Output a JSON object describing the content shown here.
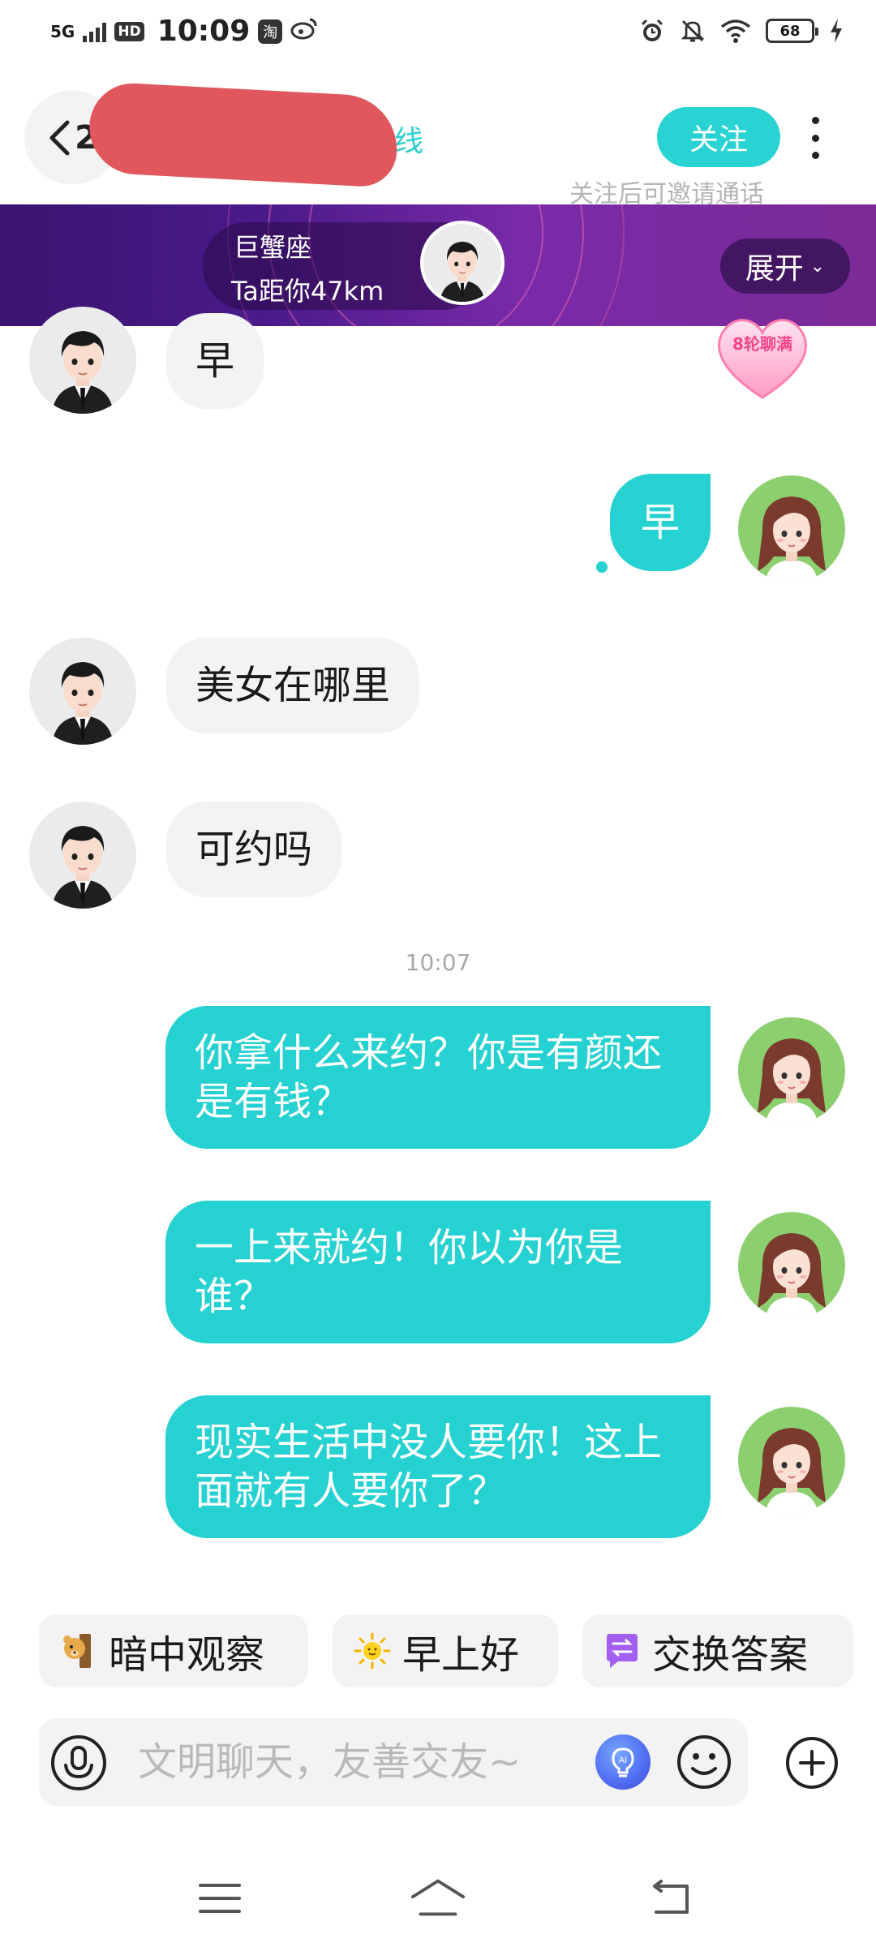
{
  "status_bar": {
    "network": "5G",
    "hd": "HD",
    "time": "10:09",
    "taobao_glyph": "淘",
    "battery": "68",
    "icons": [
      "signal-icon",
      "hd-icon",
      "taobao-icon",
      "weibo-icon",
      "alarm-icon",
      "mute-bell-icon",
      "wifi-icon",
      "battery-icon",
      "charging-icon"
    ]
  },
  "header": {
    "back_count": "2",
    "online_status": "在线",
    "follow_label": "关注",
    "follow_hint": "关注后可邀请通话"
  },
  "banner": {
    "zodiac": "巨蟹座",
    "distance": "Ta距你47km",
    "expand_label": "展开",
    "expand_chevron": "⌄"
  },
  "heart_badge": {
    "label": "8轮聊满"
  },
  "messages": [
    {
      "side": "in",
      "text": "早"
    },
    {
      "side": "out",
      "text": "早",
      "read_dot": true
    },
    {
      "side": "in",
      "text": "美女在哪里"
    },
    {
      "side": "in",
      "text": "可约吗"
    },
    {
      "type": "time",
      "text": "10:07"
    },
    {
      "side": "out",
      "text": "你拿什么来约？你是有颜还是有钱？"
    },
    {
      "side": "out",
      "text": "一上来就约！你以为你是谁？"
    },
    {
      "side": "out",
      "text": "现实生活中没人要你！这上面就有人要你了？"
    }
  ],
  "quick_replies": [
    {
      "label": "暗中观察",
      "icon": "peeking-bear-icon"
    },
    {
      "label": "早上好",
      "icon": "sun-icon"
    },
    {
      "label": "交换答案",
      "icon": "exchange-icon"
    }
  ],
  "input": {
    "placeholder": "文明聊天，友善交友~",
    "value": ""
  },
  "colors": {
    "accent": "#25d1d1",
    "banner_start": "#3a1470",
    "banner_end": "#7b2a96",
    "badge_pink": "#f2468a"
  }
}
